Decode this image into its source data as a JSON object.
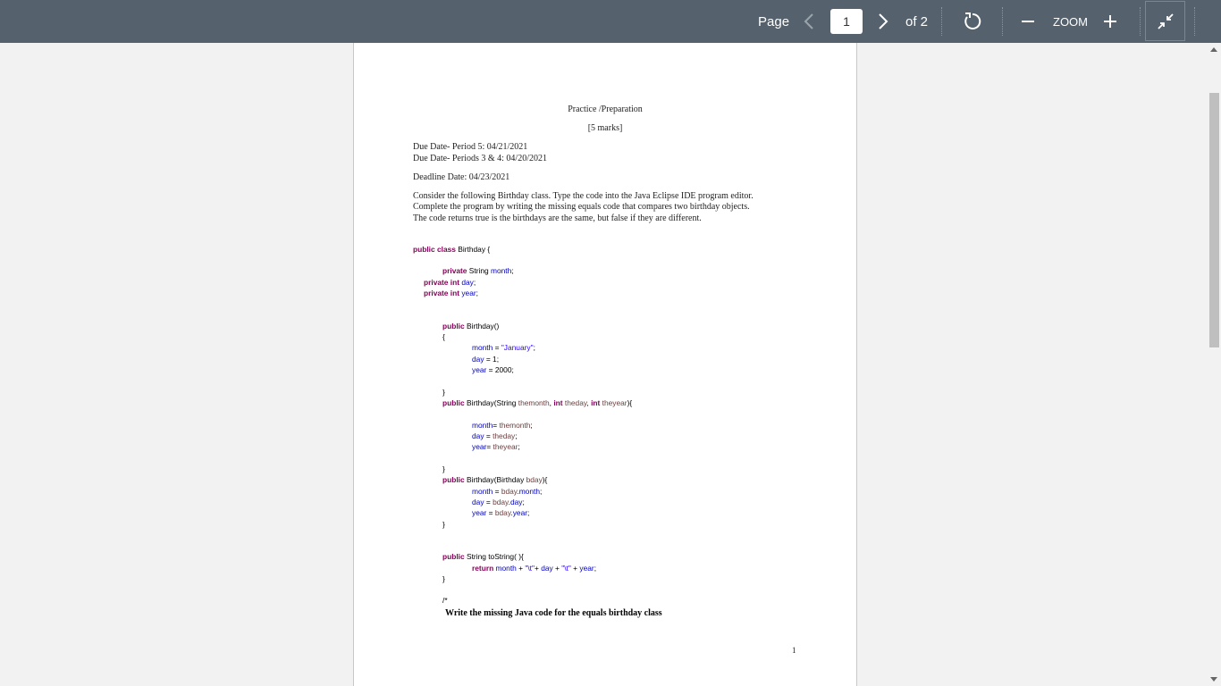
{
  "toolbar": {
    "page_label": "Page",
    "current_page": "1",
    "of_label": "of 2",
    "zoom_label": "ZOOM"
  },
  "icons": [
    "chevron-left-icon",
    "chevron-right-icon",
    "rotate-icon",
    "zoom-out-icon",
    "zoom-in-icon",
    "exit-fullscreen-icon"
  ],
  "document": {
    "title": "Practice /Preparation",
    "marks": "[5 marks]",
    "due_line_1": "Due Date- Period 5: 04/21/2021",
    "due_line_2": "Due Date- Periods 3 & 4: 04/20/2021",
    "deadline": "Deadline Date: 04/23/2021",
    "instructions": [
      "Consider the following Birthday class. Type the code into the Java Eclipse IDE program editor.",
      "Complete the program by writing the missing equals code that compares two birthday objects.",
      "The code returns true is the birthdays are the same, but false if they are different."
    ],
    "code_lines": [
      "public class Birthday {",
      "private String month;",
      "private int day;",
      "private int year;",
      "public Birthday()",
      "{",
      "month = \"January\";",
      "day = 1;",
      "year = 2000;",
      "}",
      "public Birthday(String themonth, int theday, int theyear){",
      "month= themonth;",
      "day = theday;",
      "year= theyear;",
      "}",
      "public Birthday(Birthday bday){",
      "month = bday.month;",
      "day = bday.day;",
      "year = bday.year;",
      "}",
      "public String toString( ){",
      "return month + \"\\t\"+ day + \"\\t\" + year;",
      "}",
      "/*",
      "Write the missing Java code for the equals birthday class"
    ],
    "page_number": "1"
  }
}
